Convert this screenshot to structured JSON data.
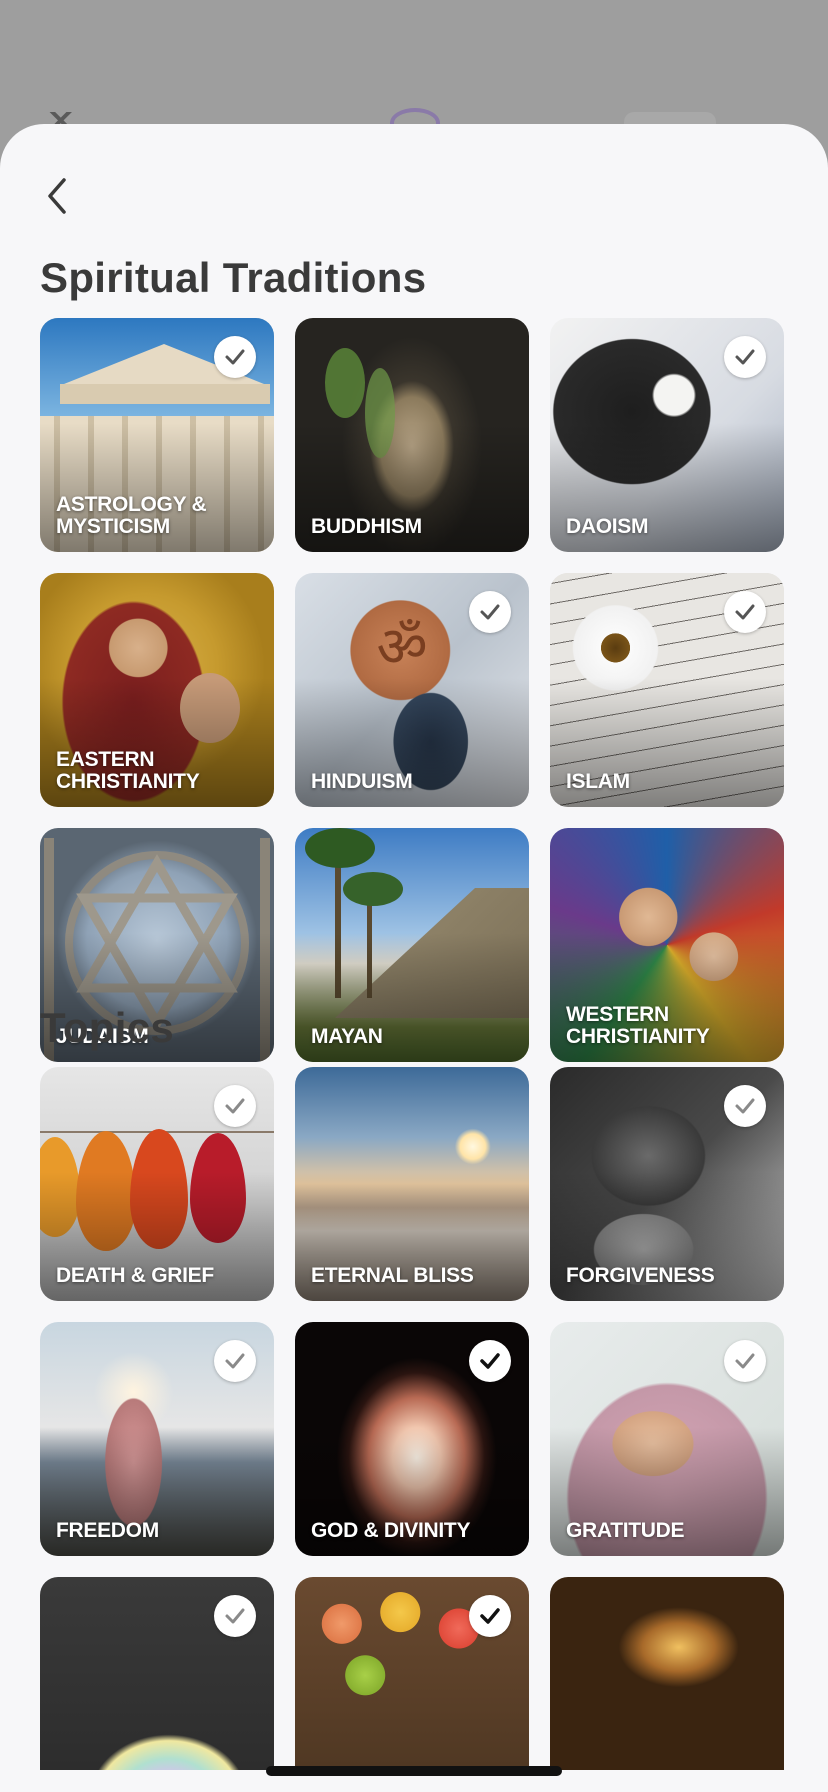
{
  "colors": {
    "sheet_bg": "#f7f7f9",
    "title_text": "#3a3a3a",
    "check_bg": "#ffffff",
    "check_mark_selected": "#111111",
    "check_mark_unselected": "#8a8a8a"
  },
  "header": {
    "back_icon": "chevron-left-icon"
  },
  "traditions": {
    "title": "Spiritual Traditions",
    "items": [
      {
        "label": "ASTROLOGY &\nMYSTICISM",
        "checked": true,
        "selected": false
      },
      {
        "label": "BUDDHISM",
        "checked": false,
        "selected": false
      },
      {
        "label": "DAOISM",
        "checked": true,
        "selected": false
      },
      {
        "label": "EASTERN\nCHRISTIANITY",
        "checked": false,
        "selected": false
      },
      {
        "label": "HINDUISM",
        "checked": true,
        "selected": false
      },
      {
        "label": "ISLAM",
        "checked": true,
        "selected": false
      },
      {
        "label": "JUDAISM",
        "checked": false,
        "selected": false
      },
      {
        "label": "MAYAN",
        "checked": false,
        "selected": false
      },
      {
        "label": "WESTERN\nCHRISTIANITY",
        "checked": false,
        "selected": false
      }
    ]
  },
  "topics": {
    "title": "Topics",
    "items": [
      {
        "label": "DEATH & GRIEF",
        "checked": true,
        "selected": false
      },
      {
        "label": "ETERNAL BLISS",
        "checked": false,
        "selected": false
      },
      {
        "label": "FORGIVENESS",
        "checked": true,
        "selected": false
      },
      {
        "label": "FREEDOM",
        "checked": true,
        "selected": false
      },
      {
        "label": "GOD & DIVINITY",
        "checked": true,
        "selected": true
      },
      {
        "label": "GRATITUDE",
        "checked": true,
        "selected": false
      },
      {
        "label": "",
        "checked": true,
        "selected": false
      },
      {
        "label": "",
        "checked": true,
        "selected": true
      },
      {
        "label": "",
        "checked": false,
        "selected": false
      }
    ]
  }
}
